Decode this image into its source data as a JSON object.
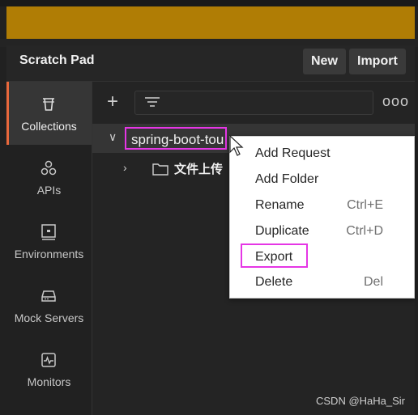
{
  "header": {
    "title": "Scratch Pad",
    "new_label": "New",
    "import_label": "Import"
  },
  "sidebar": {
    "items": [
      {
        "label": "Collections",
        "icon": "trash-can-icon",
        "active": true
      },
      {
        "label": "APIs",
        "icon": "api-nodes-icon",
        "active": false
      },
      {
        "label": "Environments",
        "icon": "environment-icon",
        "active": false
      },
      {
        "label": "Mock Servers",
        "icon": "server-icon",
        "active": false
      },
      {
        "label": "Monitors",
        "icon": "monitor-icon",
        "active": false
      }
    ]
  },
  "toolbar": {
    "add_glyph": "+",
    "more_glyph": "ooo"
  },
  "tree": {
    "collection_name": "spring-boot-tou",
    "folder_name": "文件上传"
  },
  "menu": {
    "items": [
      {
        "label": "Add Request",
        "shortcut": ""
      },
      {
        "label": "Add Folder",
        "shortcut": ""
      },
      {
        "label": "Rename",
        "shortcut": "Ctrl+E"
      },
      {
        "label": "Duplicate",
        "shortcut": "Ctrl+D"
      },
      {
        "label": "Export",
        "shortcut": ""
      },
      {
        "label": "Delete",
        "shortcut": "Del"
      }
    ]
  },
  "watermark": "CSDN @HaHa_Sir",
  "colors": {
    "banner": "#b07d05",
    "accent": "#e8683c",
    "highlight": "#e536e5"
  }
}
